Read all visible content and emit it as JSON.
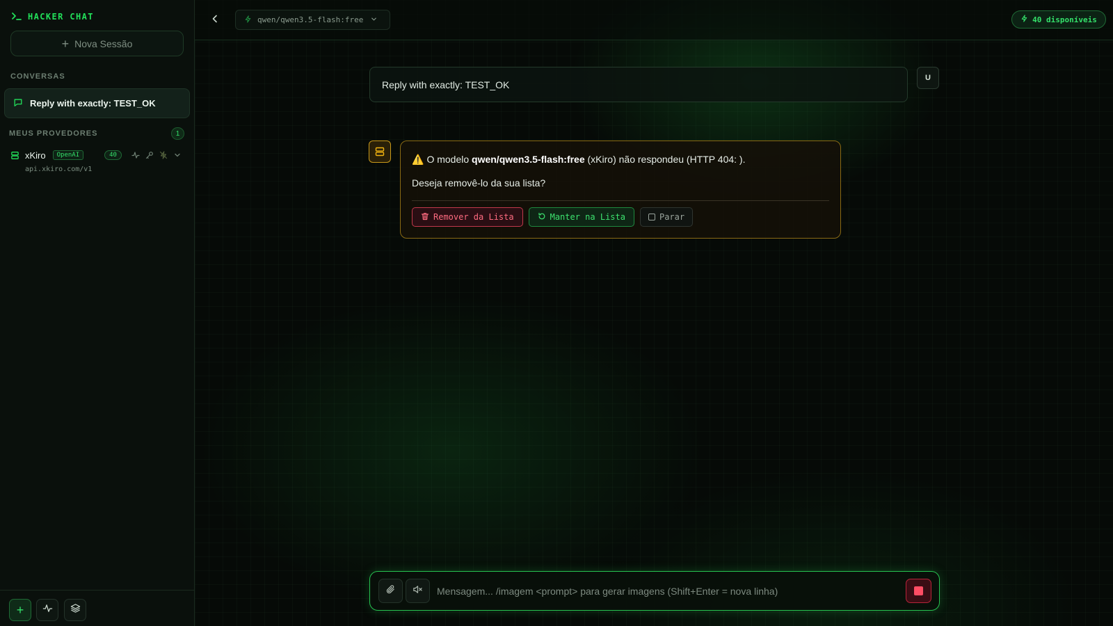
{
  "app": {
    "brand": "HACKER CHAT"
  },
  "sidebar": {
    "new_session_label": "Nova Sessão",
    "conversations_heading": "CONVERSAS",
    "conversations": [
      {
        "label": "Reply with exactly: TEST_OK",
        "active": true
      }
    ],
    "providers_heading": "MEUS PROVEDORES",
    "providers_count": "1",
    "providers": [
      {
        "name": "xKiro",
        "type": "OpenAI",
        "models": "40",
        "url": "api.xkiro.com/v1"
      }
    ],
    "footer_buttons": [
      {
        "icon": "plus-icon"
      },
      {
        "icon": "activity-icon"
      },
      {
        "icon": "layers-icon"
      }
    ]
  },
  "topbar": {
    "model": "qwen/qwen3.5-flash:free",
    "available": "40 disponíveis"
  },
  "conversation": {
    "user_message": "Reply with exactly: TEST_OK",
    "user_avatar": "U",
    "warning": {
      "prefix": "O modelo",
      "model": "qwen/qwen3.5-flash:free",
      "suffix": "(xKiro) não respondeu (HTTP 404: ).",
      "question": "Deseja removê-lo da sua lista?",
      "actions": {
        "remove": "Remover da Lista",
        "keep": "Manter na Lista",
        "stop": "Parar"
      }
    }
  },
  "composer": {
    "placeholder": "Mensagem... /imagem <prompt> para gerar imagens (Shift+Enter = nova linha)"
  },
  "colors": {
    "accent": "#22e05a",
    "danger": "#ff4d64",
    "warning": "#f2b410",
    "background": "#060a07"
  }
}
